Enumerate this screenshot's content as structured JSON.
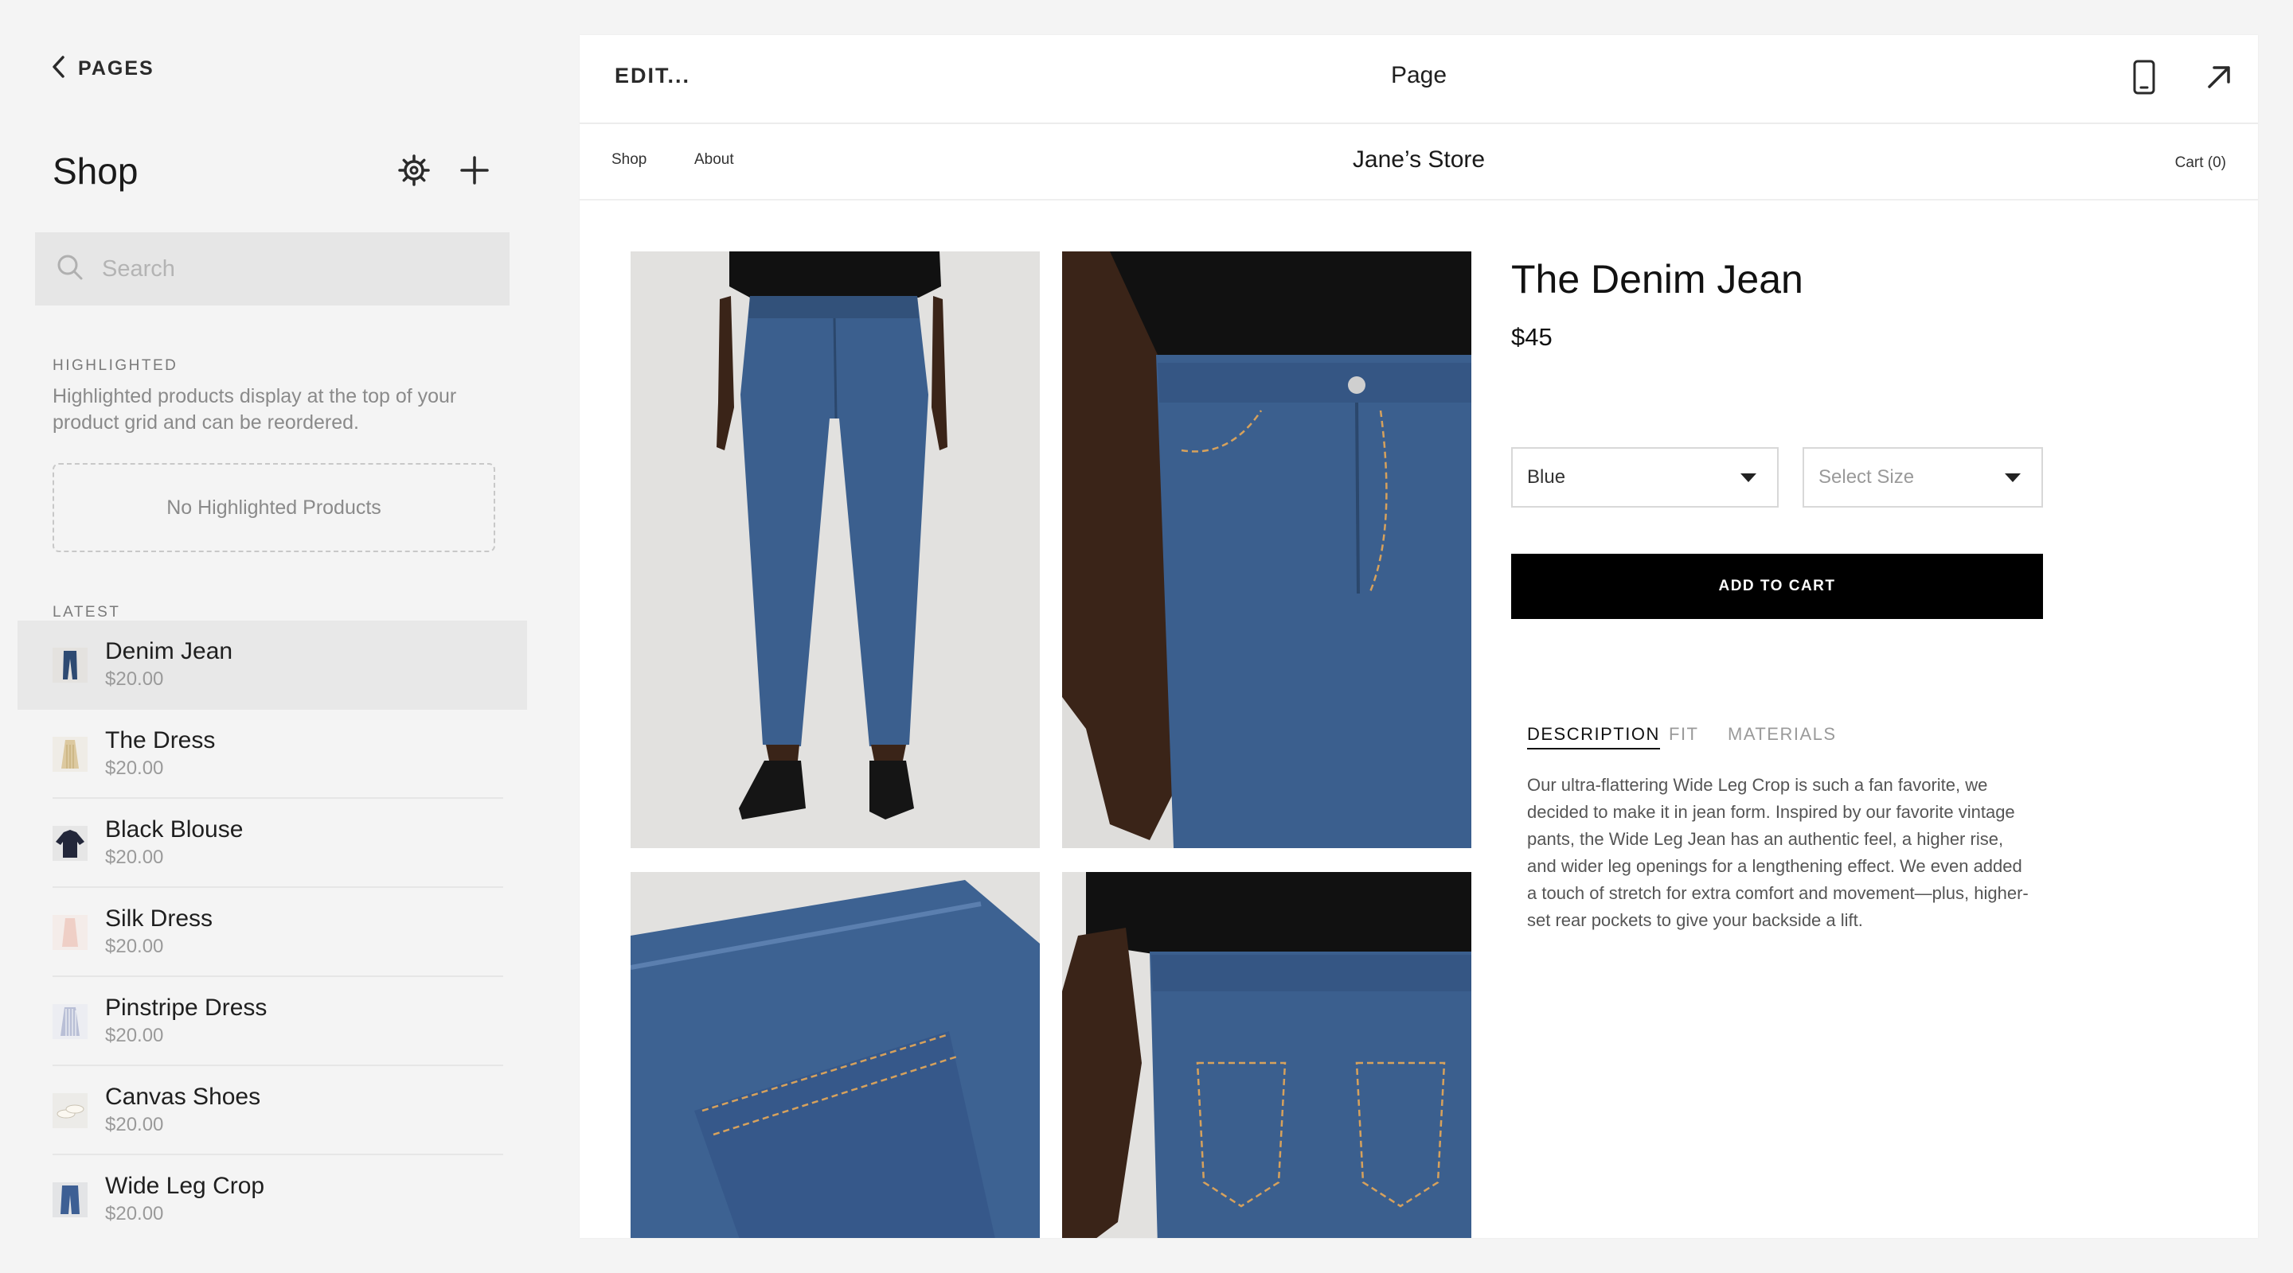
{
  "sidebar": {
    "back_label": "PAGES",
    "title": "Shop",
    "search_placeholder": "Search",
    "highlighted_label": "HIGHLIGHTED",
    "highlighted_desc": "Highlighted products display at the top of your product grid and can be reordered.",
    "empty_text": "No Highlighted Products",
    "latest_label": "LATEST",
    "products": [
      {
        "name": "Denim Jean",
        "price": "$20.00",
        "selected": true,
        "thumb_color": "#2e4a72"
      },
      {
        "name": "The Dress",
        "price": "$20.00",
        "thumb_color": "#dcc9a0"
      },
      {
        "name": "Black Blouse",
        "price": "$20.00",
        "thumb_color": "#23273a"
      },
      {
        "name": "Silk Dress",
        "price": "$20.00",
        "thumb_color": "#efcfc6"
      },
      {
        "name": "Pinstripe Dress",
        "price": "$20.00",
        "thumb_color": "#b9bfd6"
      },
      {
        "name": "Canvas Shoes",
        "price": "$20.00",
        "thumb_color": "#e2ddd2"
      },
      {
        "name": "Wide Leg Crop",
        "price": "$20.00",
        "thumb_color": "#3d5f94"
      }
    ]
  },
  "topbar": {
    "edit_label": "EDIT...",
    "page_title": "Page"
  },
  "store": {
    "nav": [
      "Shop",
      "About"
    ],
    "name": "Jane’s Store",
    "cart": "Cart (0)"
  },
  "product": {
    "title": "The Denim Jean",
    "price": "$45",
    "color_select": "Blue",
    "size_select": "Select Size",
    "add_to_cart": "ADD TO CART",
    "tabs": [
      "DESCRIPTION",
      "FIT",
      "MATERIALS"
    ],
    "active_tab": 0,
    "description": "Our ultra-flattering Wide Leg Crop is such a fan favorite, we decided to make it in jean form. Inspired by our favorite vintage pants, the Wide Leg Jean has an authentic feel, a higher rise, and wider leg openings for a lengthening effect. We even added a touch of stretch for extra comfort and movement—plus, higher-set rear pockets to give your backside a lift."
  },
  "colors": {
    "accent": "#000000",
    "sidebar_bg": "#f4f4f4",
    "selected_row": "#e8e8e8",
    "denim": "#3b5f8e"
  }
}
